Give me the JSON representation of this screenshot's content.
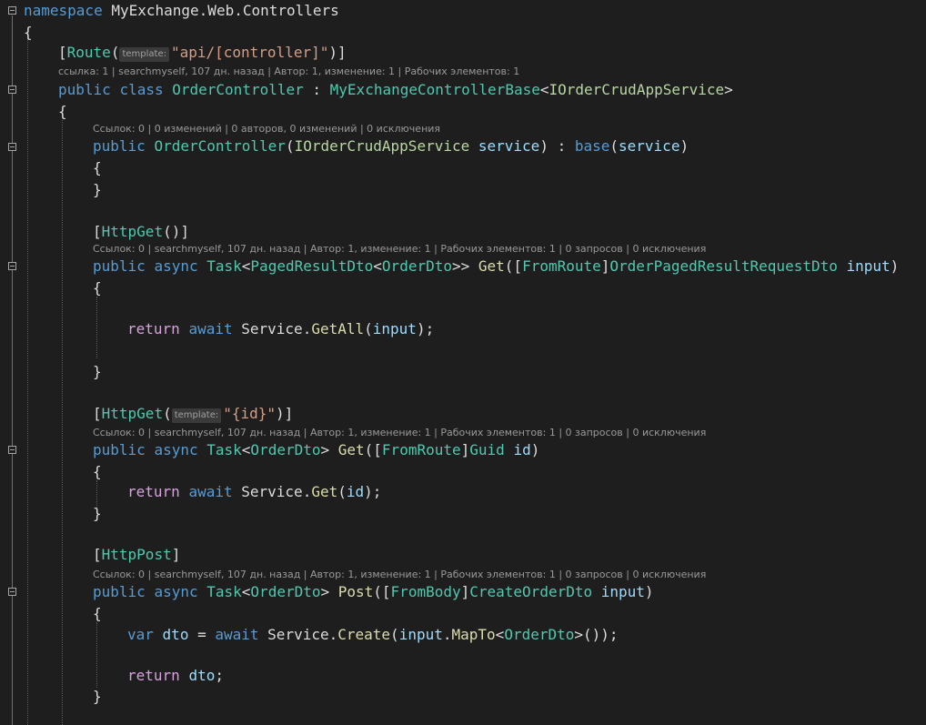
{
  "editor": {
    "theme": {
      "background": "#1e1e1e",
      "keyword": "#569cd6",
      "control_keyword": "#d8a0df",
      "type": "#4ec9b0",
      "interface": "#b8d7a3",
      "method": "#dcdcaa",
      "parameter": "#9cdcfe",
      "string": "#d69d85",
      "plain": "#dcdcdc",
      "codelens": "#999999"
    },
    "code": {
      "namespace_kw": "namespace",
      "namespace_name": "MyExchange.Web.Controllers",
      "open_brace": "{",
      "close_brace": "}",
      "route_attr": "Route",
      "hint_template": "template:",
      "route_value": "\"api/[controller]\"",
      "public_kw": "public",
      "class_kw": "class",
      "async_kw": "async",
      "class_name": "OrderController",
      "base_class": "MyExchangeControllerBase",
      "service_iface": "IOrderCrudAppService",
      "service_param": "service",
      "base_kw": "base",
      "httpget_attr": "HttpGet",
      "httppost_attr": "HttpPost",
      "task_type": "Task",
      "paged_result_type": "PagedResultDto",
      "order_dto_type": "OrderDto",
      "get_method": "Get",
      "post_method": "Post",
      "from_route_attr": "FromRoute",
      "from_body_attr": "FromBody",
      "paged_request_type": "OrderPagedResultRequestDto",
      "input_param": "input",
      "return_kw": "return",
      "await_kw": "await",
      "service_prop": "Service",
      "getall_method": "GetAll",
      "id_value": "\"{id}\"",
      "guid_type": "Guid",
      "id_param": "id",
      "create_dto_type": "CreateOrderDto",
      "var_kw": "var",
      "dto_var": "dto",
      "create_method": "Create",
      "mapto_method": "MapTo"
    },
    "codelens": {
      "class": "ссылка: 1 | searchmyself, 107 дн. назад | Автор: 1, изменение: 1 | Рабочих элементов: 1",
      "ctor": "Ссылок: 0 | 0 изменений | 0 авторов, 0 изменений | 0 исключения",
      "get_all": "Ссылок: 0 | searchmyself, 107 дн. назад | Автор: 1, изменение: 1 | Рабочих элементов: 1 | 0 запросов | 0 исключения",
      "get_by_id": "Ссылок: 0 | searchmyself, 107 дн. назад | Автор: 1, изменение: 1 | Рабочих элементов: 1 | 0 запросов | 0 исключения",
      "post": "Ссылок: 0 | searchmyself, 107 дн. назад | Автор: 1, изменение: 1 | Рабочих элементов: 1 | 0 запросов | 0 исключения"
    }
  }
}
